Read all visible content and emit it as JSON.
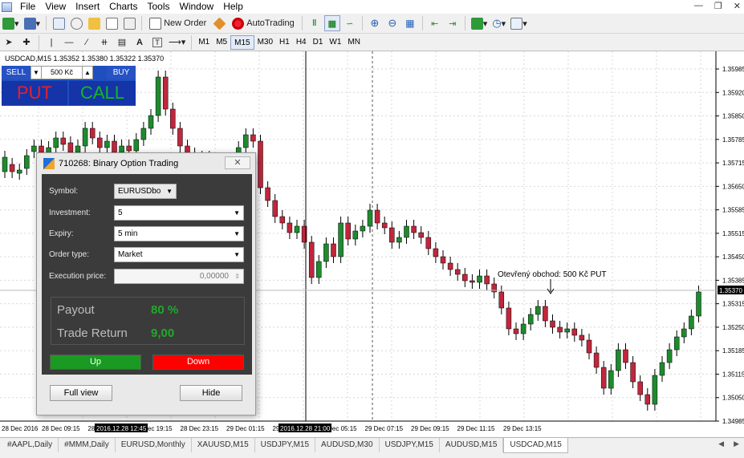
{
  "menu": {
    "items": [
      "File",
      "View",
      "Insert",
      "Charts",
      "Tools",
      "Window",
      "Help"
    ],
    "underline_index": [
      0,
      0,
      0,
      0,
      0,
      0,
      0
    ]
  },
  "toolbar": {
    "new_order": "New Order",
    "auto_trading": "AutoTrading",
    "timeframes": [
      "M1",
      "M5",
      "M15",
      "M30",
      "H1",
      "H4",
      "D1",
      "W1",
      "MN"
    ],
    "active_timeframe": "M15"
  },
  "chart": {
    "symbol_info": "USDCAD,M15  1.35352 1.35380 1.35322 1.35370",
    "price_labels": [
      "1.35985",
      "1.35920",
      "1.35850",
      "1.35785",
      "1.35715",
      "1.35650",
      "1.35585",
      "1.35515",
      "1.35450",
      "1.35385",
      "1.35315",
      "1.35250",
      "1.35185",
      "1.35115",
      "1.35050",
      "1.34985"
    ],
    "current_price": "1.35370",
    "time_labels": [
      "28 Dec 2016",
      "28 Dec 09:15",
      "28 Dec 15:15",
      "28 Dec 19:15",
      "28 Dec 23:15",
      "29 Dec 01:15",
      "29 Dec 03:15",
      "29 Dec 05:15",
      "29 Dec 07:15",
      "29 Dec 09:15",
      "29 Dec 11:15",
      "29 Dec 13:15"
    ],
    "crosshair_time_1": "2016.12.28 12:45",
    "crosshair_time_2": "2016.12.28 21:00",
    "annotation": "Otevřený obchod: 500 Kč PUT",
    "colors": {
      "bull": "#1e8b2d",
      "bear": "#c0263c",
      "wick": "#000000"
    }
  },
  "trade_panel": {
    "sell": "SELL",
    "buy": "BUY",
    "amount": "500 Kč",
    "put": "PUT",
    "call": "CALL"
  },
  "dialog": {
    "title": "710268: Binary Option Trading",
    "close_icon": "x-icon",
    "symbol_label": "Symbol:",
    "symbol_value": "EURUSDbo",
    "investment_label": "Investment:",
    "investment_value": "5",
    "expiry_label": "Expiry:",
    "expiry_value": "5 min",
    "order_type_label": "Order type:",
    "order_type_value": "Market",
    "execution_price_label": "Execution price:",
    "execution_price_value": "0,00000",
    "payout_label": "Payout",
    "payout_value": "80 %",
    "trade_return_label": "Trade Return",
    "trade_return_value": "9,00",
    "up_label": "Up",
    "down_label": "Down",
    "full_view_label": "Full view",
    "hide_label": "Hide"
  },
  "tabs": [
    "#AAPL,Daily",
    "#MMM,Daily",
    "EURUSD,Monthly",
    "XAUUSD,M15",
    "USDJPY,M15",
    "AUDUSD,M30",
    "USDJPY,M15",
    "AUDUSD,M15",
    "USDCAD,M15"
  ],
  "active_tab": "USDCAD,M15"
}
